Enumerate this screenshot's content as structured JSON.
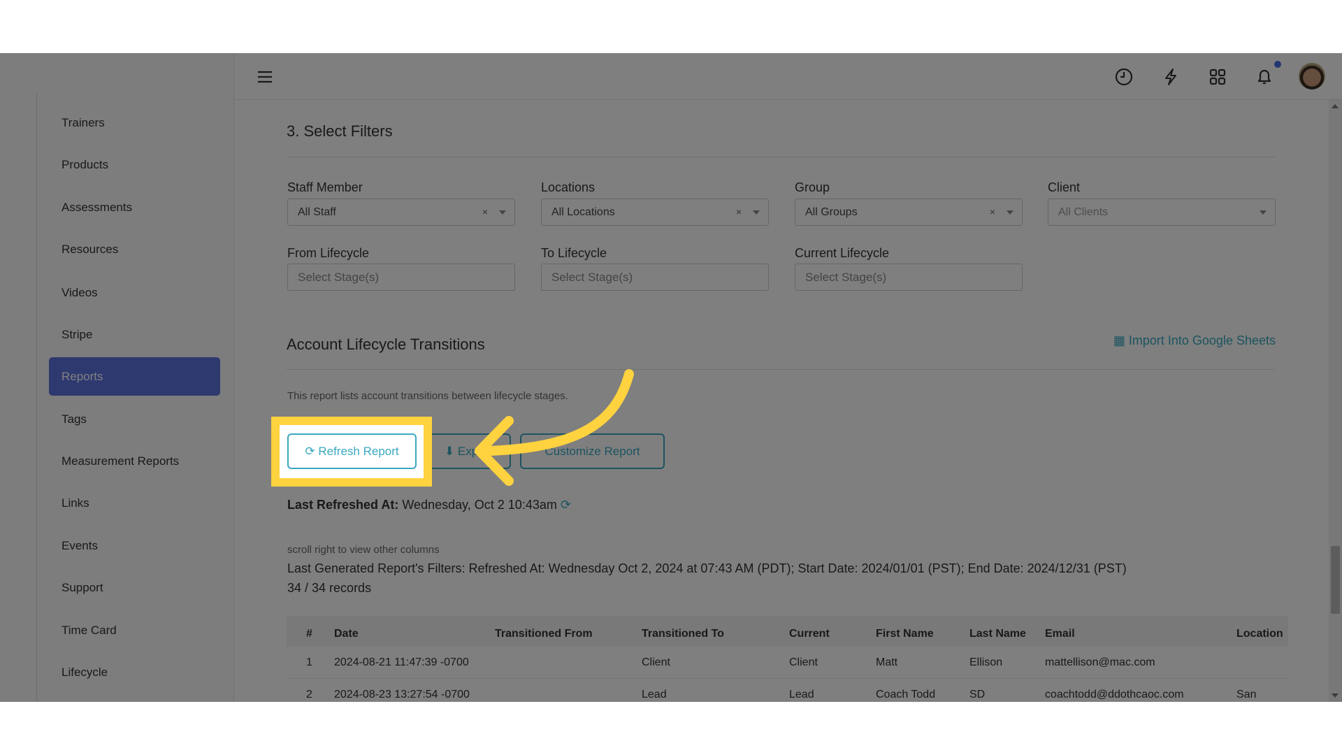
{
  "sidebar": {
    "items": [
      {
        "label": "Trainers"
      },
      {
        "label": "Products"
      },
      {
        "label": "Assessments"
      },
      {
        "label": "Resources"
      },
      {
        "label": "Videos"
      },
      {
        "label": "Stripe"
      },
      {
        "label": "Reports",
        "active": true
      },
      {
        "label": "Tags"
      },
      {
        "label": "Measurement Reports"
      },
      {
        "label": "Links"
      },
      {
        "label": "Events"
      },
      {
        "label": "Support"
      },
      {
        "label": "Time Card"
      },
      {
        "label": "Lifecycle"
      }
    ]
  },
  "topbar": {
    "icons": [
      "menu-icon",
      "clock-icon",
      "lightning-icon",
      "apps-grid-icon",
      "bell-icon",
      "avatar"
    ],
    "notification_dot_color": "#4a6fe0"
  },
  "filters": {
    "title": "3. Select Filters",
    "staff": {
      "label": "Staff Member",
      "value": "All Staff"
    },
    "locations": {
      "label": "Locations",
      "value": "All Locations"
    },
    "group": {
      "label": "Group",
      "value": "All Groups"
    },
    "client": {
      "label": "Client",
      "value": "All Clients"
    },
    "from_lifecycle": {
      "label": "From Lifecycle",
      "placeholder": "Select Stage(s)"
    },
    "to_lifecycle": {
      "label": "To Lifecycle",
      "placeholder": "Select Stage(s)"
    },
    "current_lifecycle": {
      "label": "Current Lifecycle",
      "placeholder": "Select Stage(s)"
    },
    "clear_symbol": "×"
  },
  "report": {
    "title": "Account Lifecycle Transitions",
    "import_link": "Import Into Google Sheets",
    "description": "This report lists account transitions between lifecycle stages.",
    "refresh_label": "Refresh Report",
    "export_label": "Export",
    "customize_label": "Customize Report",
    "last_refreshed_label": "Last Refreshed At:",
    "last_refreshed_value": "Wednesday, Oct 2 10:43am",
    "scroll_hint": "scroll right to view other columns",
    "generated_filters": "Last Generated Report's Filters: Refreshed At: Wednesday Oct 2, 2024 at 07:43 AM (PDT); Start Date: 2024/01/01 (PST); End Date: 2024/12/31 (PST)",
    "records": "34 / 34 records",
    "accent_color": "#3aa9c0",
    "highlight_color": "#ffd23f"
  },
  "table": {
    "columns": [
      "#",
      "Date",
      "Transitioned From",
      "Transitioned To",
      "Current",
      "First Name",
      "Last Name",
      "Email",
      "Location"
    ],
    "rows": [
      [
        "1",
        "2024-08-21 11:47:39 -0700",
        "",
        "Client",
        "Client",
        "Matt",
        "Ellison",
        "mattellison@mac.com",
        ""
      ],
      [
        "2",
        "2024-08-23 13:27:54 -0700",
        "",
        "Lead",
        "Lead",
        "Coach Todd",
        "SD",
        "coachtodd@ddothcaoc.com",
        "San Diego"
      ]
    ]
  }
}
